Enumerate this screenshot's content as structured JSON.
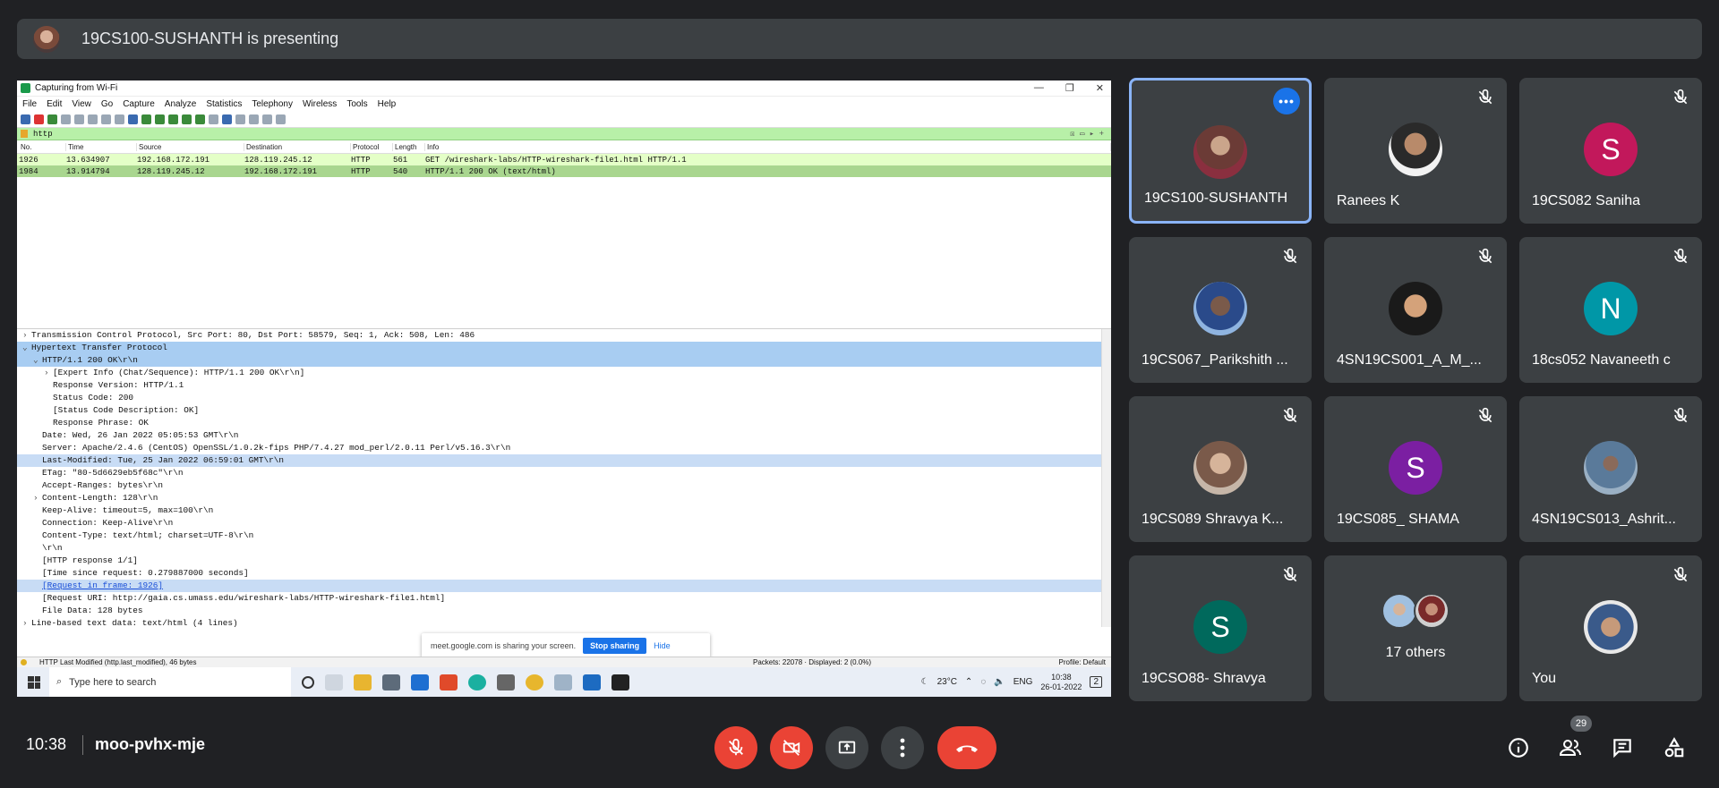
{
  "presenting": {
    "text": "19CS100-SUSHANTH is presenting"
  },
  "wireshark": {
    "title": "Capturing from Wi-Fi",
    "menu": [
      "File",
      "Edit",
      "View",
      "Go",
      "Capture",
      "Analyze",
      "Statistics",
      "Telephony",
      "Wireless",
      "Tools",
      "Help"
    ],
    "filter": "http",
    "columns": [
      "No.",
      "Time",
      "Source",
      "Destination",
      "Protocol",
      "Length",
      "Info"
    ],
    "packets": [
      [
        "1926",
        "13.634907",
        "192.168.172.191",
        "128.119.245.12",
        "HTTP",
        "561",
        "GET /wireshark-labs/HTTP-wireshark-file1.html HTTP/1.1"
      ],
      [
        "1984",
        "13.914794",
        "128.119.245.12",
        "192.168.172.191",
        "HTTP",
        "540",
        "HTTP/1.1 200 OK  (text/html)"
      ]
    ],
    "details": [
      "Transmission Control Protocol, Src Port: 80, Dst Port: 58579, Seq: 1, Ack: 508, Len: 486",
      "Hypertext Transfer Protocol",
      "HTTP/1.1 200 OK\\r\\n",
      "[Expert Info (Chat/Sequence): HTTP/1.1 200 OK\\r\\n]",
      "Response Version: HTTP/1.1",
      "Status Code: 200",
      "[Status Code Description: OK]",
      "Response Phrase: OK",
      "Date: Wed, 26 Jan 2022 05:05:53 GMT\\r\\n",
      "Server: Apache/2.4.6 (CentOS) OpenSSL/1.0.2k-fips PHP/7.4.27 mod_perl/2.0.11 Perl/v5.16.3\\r\\n",
      "Last-Modified: Tue, 25 Jan 2022 06:59:01 GMT\\r\\n",
      "ETag: \"80-5d6629eb5f68c\"\\r\\n",
      "Accept-Ranges: bytes\\r\\n",
      "Content-Length: 128\\r\\n",
      "Keep-Alive: timeout=5, max=100\\r\\n",
      "Connection: Keep-Alive\\r\\n",
      "Content-Type: text/html; charset=UTF-8\\r\\n",
      "\\r\\n",
      "[HTTP response 1/1]",
      "[Time since request: 0.279887000 seconds]",
      "[Request in frame: 1926]",
      "[Request URI: http://gaia.cs.umass.edu/wireshark-labs/HTTP-wireshark-file1.html]",
      "File Data: 128 bytes",
      "Line-based text data: text/html (4 lines)"
    ],
    "share_banner": {
      "text": "meet.google.com is sharing your screen.",
      "stop": "Stop sharing",
      "hide": "Hide"
    },
    "status": {
      "left": "HTTP Last Modified (http.last_modified), 46 bytes",
      "packets": "Packets: 22078 · Displayed: 2 (0.0%)",
      "profile": "Profile: Default"
    },
    "taskbar": {
      "search_placeholder": "Type here to search",
      "weather": "23°C",
      "lang": "ENG",
      "time": "10:38",
      "date": "26-01-2022",
      "notif": "2"
    }
  },
  "participants": [
    {
      "name": "19CS100-SUSHANTH"
    },
    {
      "name": "Ranees K"
    },
    {
      "name": "19CS082 Saniha",
      "initial": "S",
      "color": "#c2185b"
    },
    {
      "name": "19CS067_Parikshith ..."
    },
    {
      "name": "4SN19CS001_A_M_..."
    },
    {
      "name": "18cs052 Navaneeth c",
      "initial": "N",
      "color": "#0097a7"
    },
    {
      "name": "19CS089 Shravya K..."
    },
    {
      "name": "19CS085_ SHAMA",
      "initial": "S",
      "color": "#7b1fa2"
    },
    {
      "name": "4SN19CS013_Ashrit..."
    },
    {
      "name": "19CSO88- Shravya",
      "initial": "S",
      "color": "#00695c"
    },
    {
      "name": "17 others"
    },
    {
      "name": "You"
    }
  ],
  "meeting": {
    "time": "10:38",
    "code": "moo-pvhx-mje",
    "people_count": "29"
  }
}
